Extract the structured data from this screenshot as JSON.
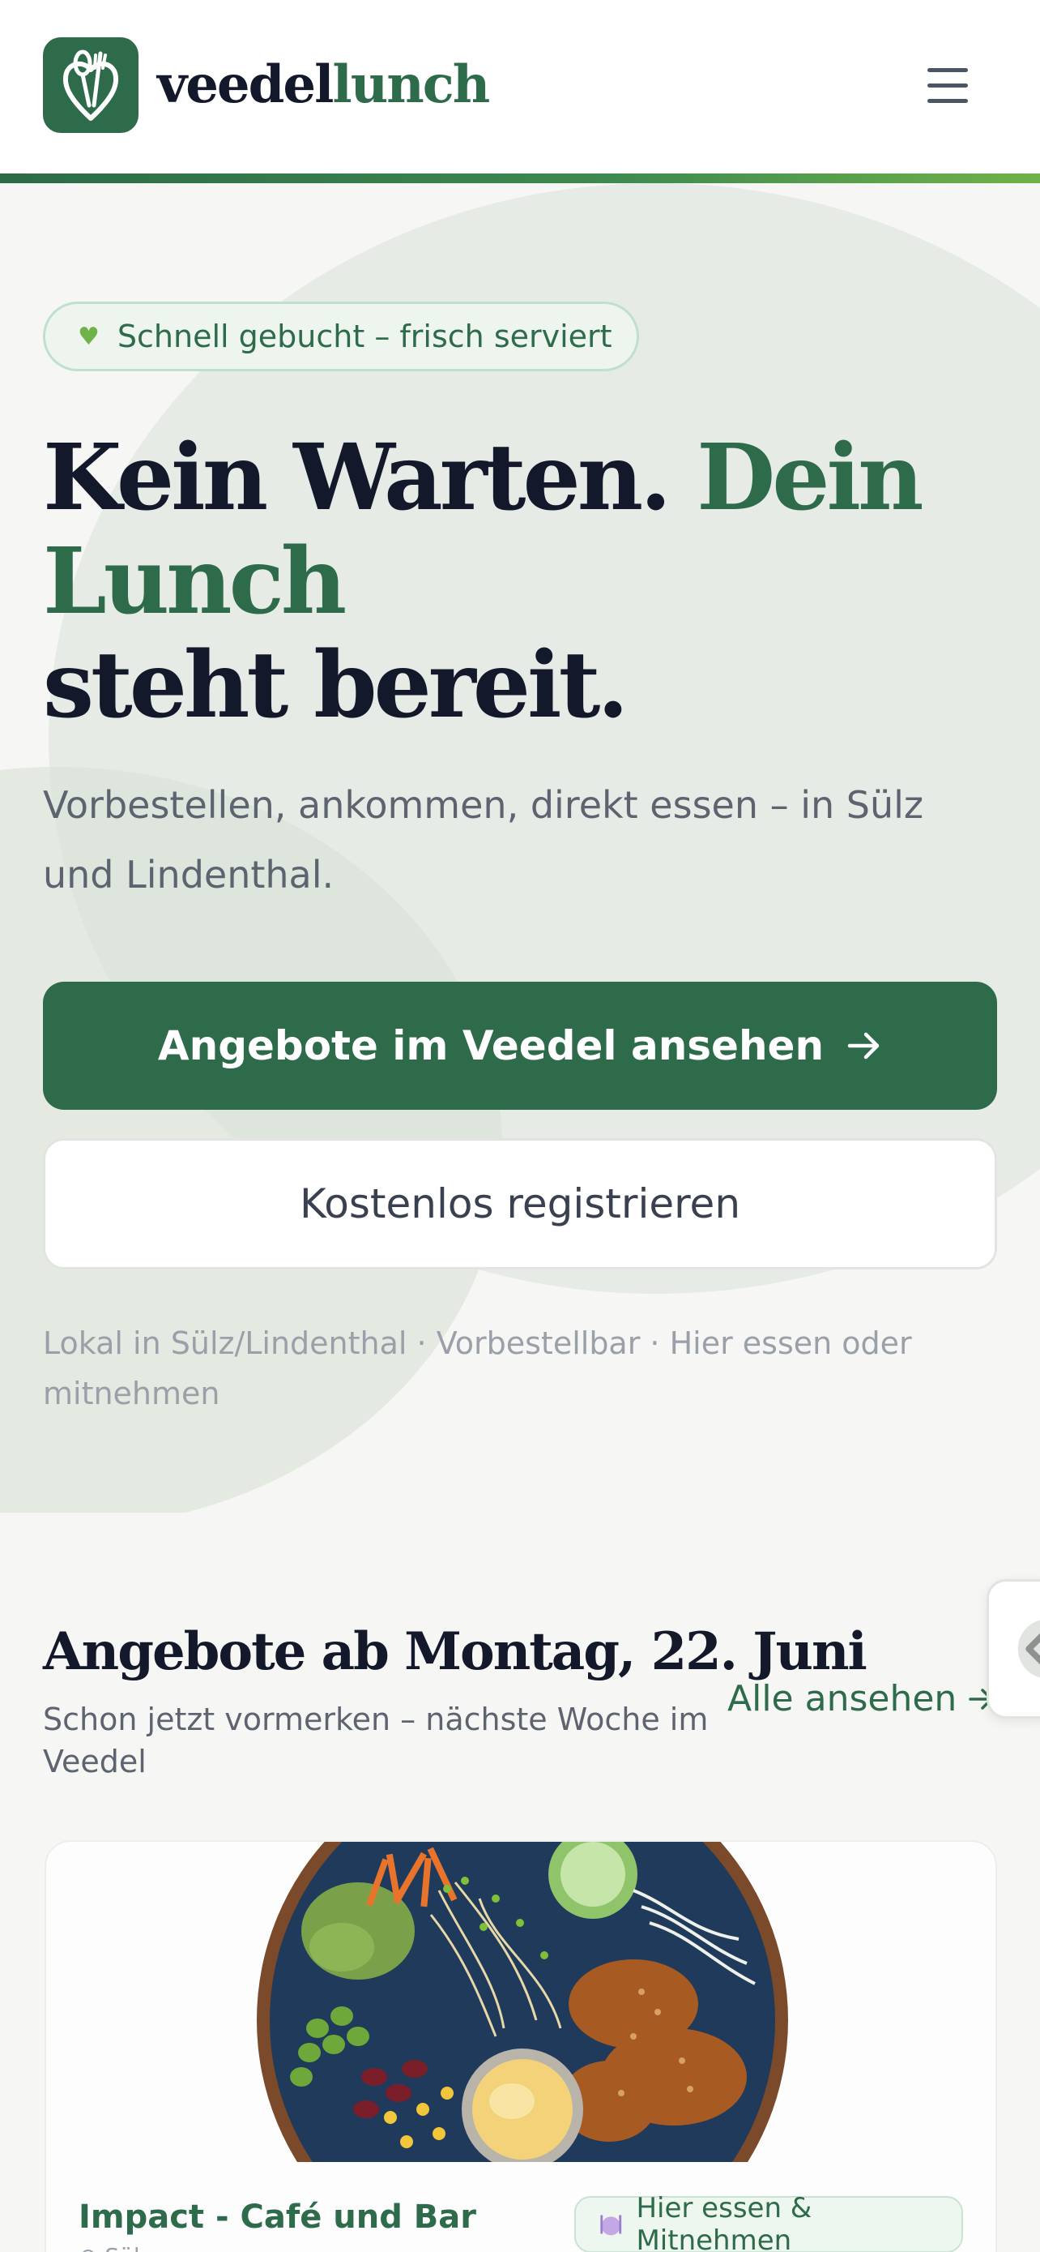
{
  "header": {
    "logo_part1": "veedel",
    "logo_part2": "lunch"
  },
  "hero": {
    "badge": "Schnell gebucht – frisch serviert",
    "headline_part1": "Kein Warten. ",
    "headline_green": "Dein Lunch",
    "headline_part2": "steht bereit.",
    "subhead": "Vorbestellen, ankommen, direkt essen – in Sülz und Lindenthal.",
    "cta_primary": "Angebote im Veedel ansehen",
    "cta_secondary": "Kostenlos registrieren",
    "meta": "Lokal in Sülz/Lindenthal · Vorbestellbar · Hier essen oder mitnehmen"
  },
  "offers": {
    "title": "Angebote ab Montag, 22. Juni",
    "subtitle": "Schon jetzt vormerken – nächste Woche im Veedel",
    "see_all": "Alle ansehen",
    "cards": [
      {
        "restaurant": "Impact - Café und Bar",
        "location": "Sülz",
        "badge": "Hier essen & Mitnehmen",
        "badge_icon": "plate-icon"
      }
    ]
  },
  "colors": {
    "brand_green": "#2e6b4b",
    "accent_green": "#6fb24a",
    "text_dark": "#13192b"
  }
}
